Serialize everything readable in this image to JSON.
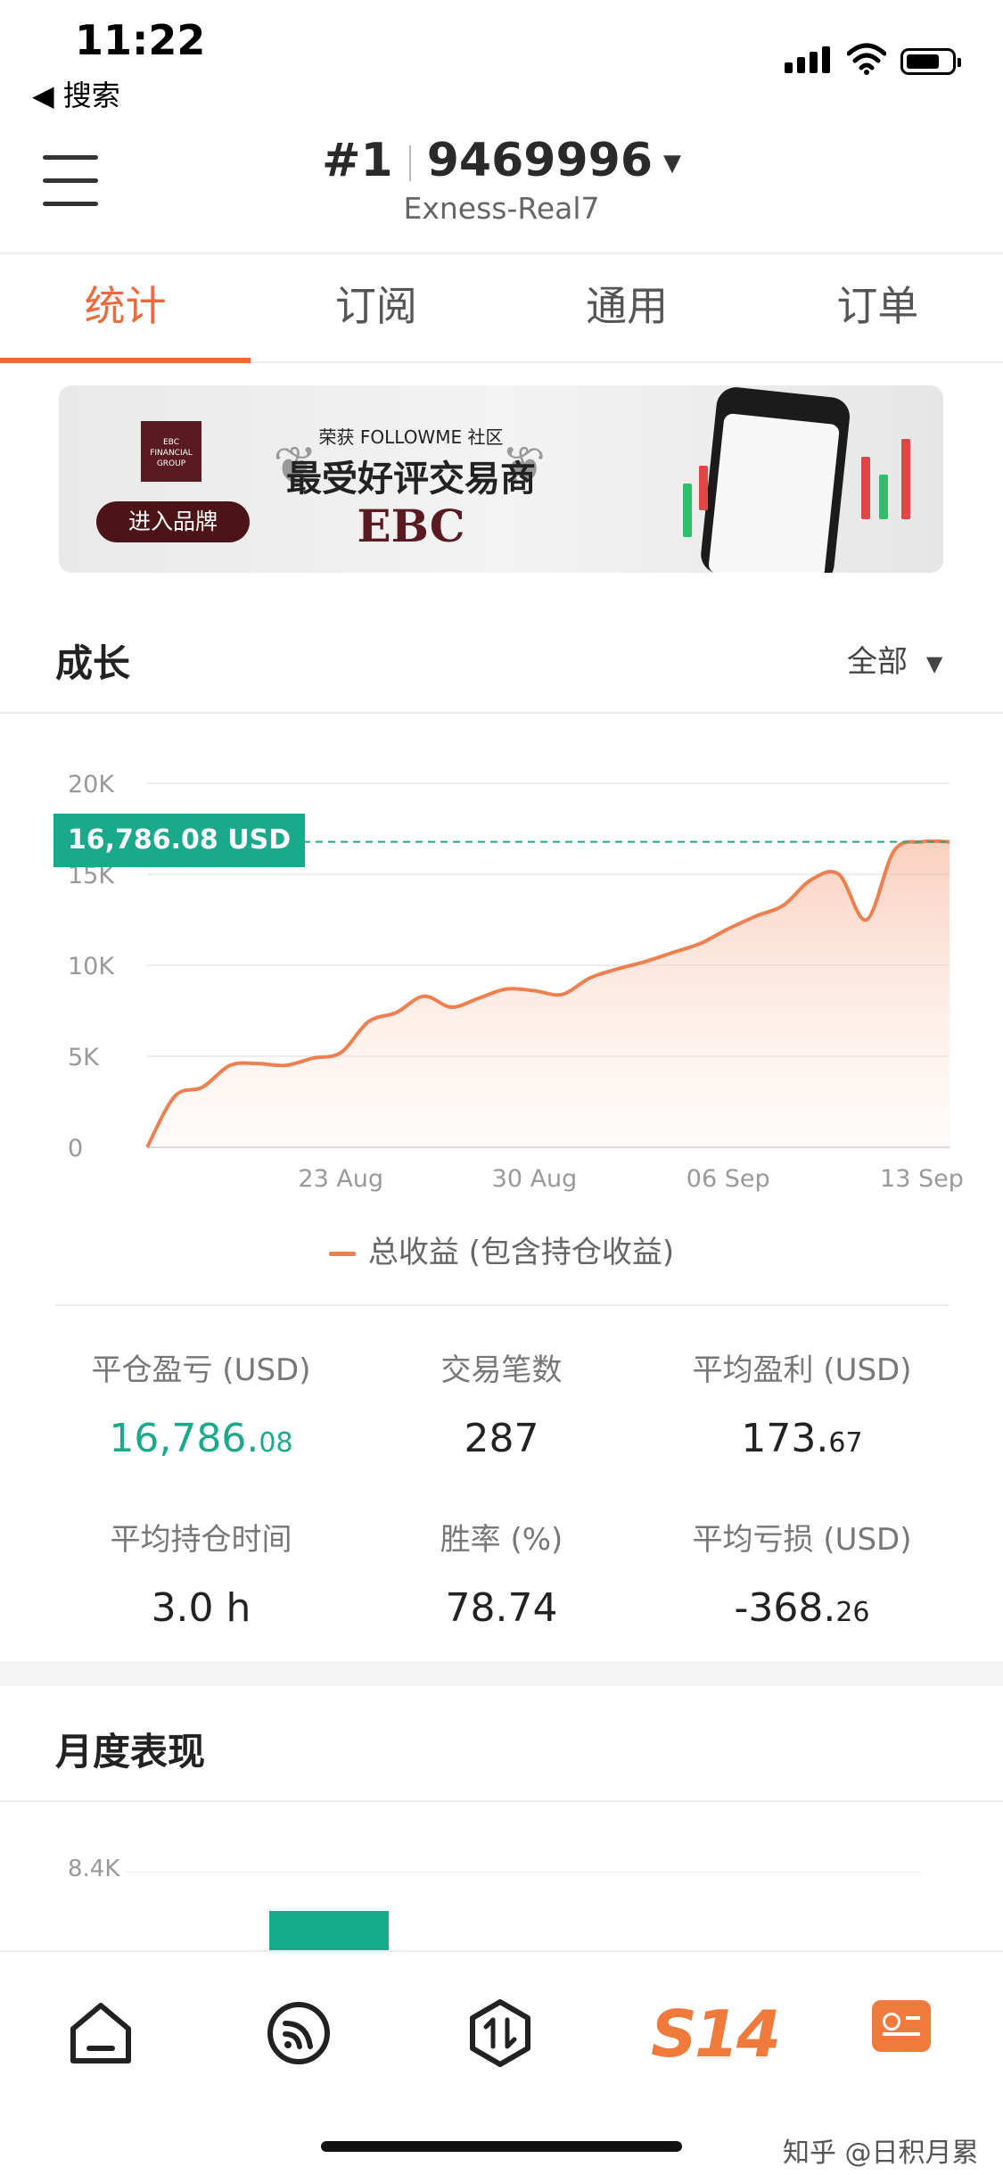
{
  "status_bar": {
    "time": "11:22",
    "back_label": "◀ 搜索"
  },
  "header": {
    "rank": "#1",
    "account": "9469996",
    "server": "Exness-Real7"
  },
  "tabs": [
    {
      "label": "统计",
      "active": true
    },
    {
      "label": "订阅",
      "active": false
    },
    {
      "label": "通用",
      "active": false
    },
    {
      "label": "订单",
      "active": false
    }
  ],
  "banner": {
    "brand_button": "进入品牌",
    "subtitle": "荣获 FOLLOWME 社区",
    "title": "最受好评交易商",
    "brand": "EBC",
    "logo_text": "EBC FINANCIAL GROUP"
  },
  "growth": {
    "title": "成长",
    "filter": "全部",
    "current_label": "16,786.08 USD",
    "legend": "总收益 (包含持仓收益)"
  },
  "chart_data": {
    "type": "area",
    "yticks": [
      "20K",
      "15K",
      "10K",
      "5K",
      "0"
    ],
    "xticks": [
      "23 Aug",
      "30 Aug",
      "06 Sep",
      "13 Sep"
    ],
    "ylim": [
      0,
      20000
    ],
    "current_value": 16786.08,
    "series": [
      {
        "name": "总收益 (包含持仓收益)",
        "color": "#f07f4f",
        "x": [
          "16 Aug",
          "17 Aug",
          "18 Aug",
          "19 Aug",
          "20 Aug",
          "21 Aug",
          "22 Aug",
          "23 Aug",
          "24 Aug",
          "25 Aug",
          "26 Aug",
          "27 Aug",
          "28 Aug",
          "29 Aug",
          "30 Aug",
          "31 Aug",
          "01 Sep",
          "02 Sep",
          "03 Sep",
          "04 Sep",
          "05 Sep",
          "06 Sep",
          "07 Sep",
          "08 Sep",
          "09 Sep",
          "10 Sep",
          "11 Sep",
          "12 Sep",
          "13 Sep",
          "14 Sep"
        ],
        "values": [
          0,
          2800,
          3300,
          4500,
          4600,
          4500,
          4900,
          5200,
          6900,
          7400,
          8300,
          7700,
          8200,
          8700,
          8600,
          8400,
          9300,
          9800,
          10200,
          10700,
          11200,
          12000,
          12700,
          13300,
          14700,
          15000,
          12500,
          16300,
          16786,
          16786
        ]
      }
    ]
  },
  "stats": [
    {
      "label": "平仓盈亏 (USD)",
      "int": "16,786.",
      "dec": "08",
      "color": "green"
    },
    {
      "label": "交易笔数",
      "int": "287",
      "dec": "",
      "color": "default"
    },
    {
      "label": "平均盈利 (USD)",
      "int": "173.",
      "dec": "67",
      "color": "default"
    },
    {
      "label": "平均持仓时间",
      "int": "3.0 h",
      "dec": "",
      "color": "default"
    },
    {
      "label": "胜率 (%)",
      "int": "78.74",
      "dec": "",
      "color": "default"
    },
    {
      "label": "平均亏损 (USD)",
      "int": "-368.",
      "dec": "26",
      "color": "default"
    }
  ],
  "monthly": {
    "title": "月度表现",
    "ytick": "8.4K"
  },
  "bottom_nav": {
    "items": [
      {
        "icon": "home-icon"
      },
      {
        "icon": "feed-icon"
      },
      {
        "icon": "trade-icon"
      },
      {
        "icon": "s14-logo",
        "label": "S14"
      },
      {
        "icon": "profile-card-icon"
      }
    ]
  },
  "watermark": "知乎 @日积月累"
}
